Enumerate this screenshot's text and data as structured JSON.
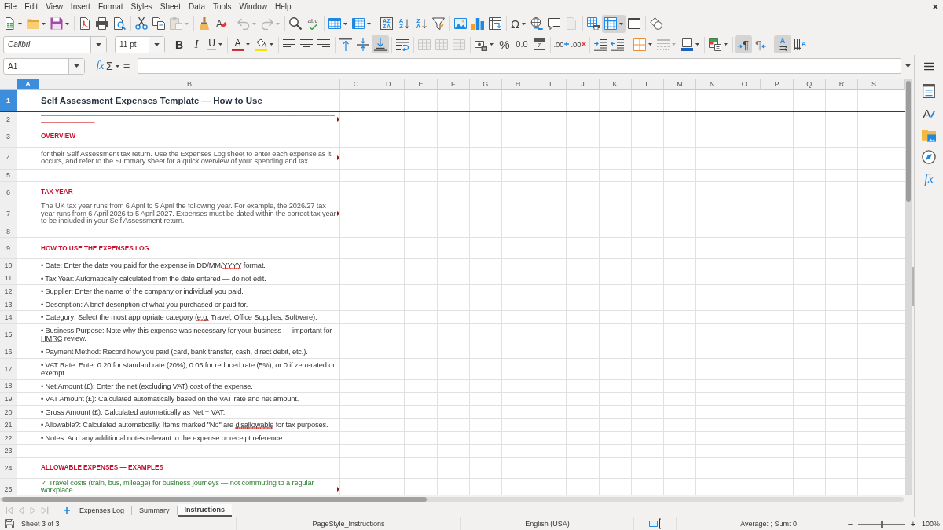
{
  "menu_bar": {
    "items": [
      "File",
      "Edit",
      "View",
      "Insert",
      "Format",
      "Styles",
      "Sheet",
      "Data",
      "Tools",
      "Window",
      "Help"
    ],
    "close": "×"
  },
  "standard_toolbar": {
    "groups": [
      [
        {
          "kind": "new",
          "dropdown": true,
          "disabled": false,
          "pressed": false
        },
        {
          "kind": "open",
          "dropdown": true,
          "disabled": false,
          "pressed": false
        },
        {
          "kind": "save",
          "dropdown": true,
          "disabled": false,
          "pressed": false
        }
      ],
      [
        {
          "kind": "export_pdf",
          "disabled": false,
          "pressed": false
        },
        {
          "kind": "print",
          "disabled": false,
          "pressed": false
        },
        {
          "kind": "print_preview",
          "disabled": false,
          "pressed": false
        }
      ],
      [
        {
          "kind": "cut",
          "disabled": false,
          "pressed": false
        },
        {
          "kind": "copy",
          "disabled": false,
          "pressed": false
        },
        {
          "kind": "paste",
          "dropdown": true,
          "disabled": true,
          "pressed": false
        }
      ],
      [
        {
          "kind": "clone_format",
          "disabled": false,
          "pressed": false
        },
        {
          "kind": "clear_format",
          "glyph": "A",
          "disabled": false,
          "pressed": false
        }
      ],
      [
        {
          "kind": "undo",
          "dropdown": true,
          "disabled": true,
          "pressed": false
        },
        {
          "kind": "redo",
          "dropdown": true,
          "disabled": true,
          "pressed": false
        }
      ],
      [
        {
          "kind": "find_replace",
          "disabled": false,
          "pressed": false
        },
        {
          "kind": "spelling",
          "glyph": "abc",
          "disabled": false,
          "pressed": false
        }
      ],
      [
        {
          "kind": "insert_rows",
          "dropdown": true,
          "disabled": false,
          "pressed": false
        },
        {
          "kind": "insert_columns",
          "dropdown": true,
          "disabled": false,
          "pressed": false
        }
      ],
      [
        {
          "kind": "sort",
          "glyph": "AZZA",
          "disabled": false,
          "pressed": false
        },
        {
          "kind": "sort_ascending",
          "glyph": "AZ",
          "disabled": false,
          "pressed": false
        },
        {
          "kind": "sort_descending",
          "glyph": "ZA",
          "disabled": false,
          "pressed": false
        },
        {
          "kind": "autofilter",
          "disabled": false,
          "pressed": false
        }
      ],
      [
        {
          "kind": "image",
          "disabled": false,
          "pressed": false
        },
        {
          "kind": "chart",
          "disabled": false,
          "pressed": false
        },
        {
          "kind": "pivot_table",
          "disabled": false,
          "pressed": false
        }
      ],
      [
        {
          "kind": "special_character",
          "glyph": "Ω",
          "dropdown": true,
          "disabled": false,
          "pressed": false
        },
        {
          "kind": "hyperlink",
          "disabled": false,
          "pressed": false
        },
        {
          "kind": "comment",
          "disabled": false,
          "pressed": false
        },
        {
          "kind": "header_footer",
          "disabled": true,
          "pressed": false
        }
      ],
      [
        {
          "kind": "print_area",
          "disabled": false,
          "pressed": false
        },
        {
          "kind": "freeze",
          "dropdown": true,
          "disabled": false,
          "pressed": true
        },
        {
          "kind": "split_window",
          "disabled": false,
          "pressed": false
        }
      ],
      [
        {
          "kind": "shapes",
          "disabled": false,
          "pressed": false
        }
      ]
    ]
  },
  "formatting_toolbar": {
    "font_name": "Calibri",
    "font_size": "11 pt",
    "groups": [
      [
        {
          "kind": "bold",
          "glyph": "B",
          "disabled": false,
          "pressed": false
        },
        {
          "kind": "italic",
          "glyph": "I",
          "disabled": false,
          "pressed": false
        },
        {
          "kind": "underline",
          "glyph": "U",
          "dropdown": true,
          "disabled": false,
          "pressed": false
        }
      ],
      [
        {
          "kind": "font_color",
          "glyph": "A",
          "dropdown": true,
          "disabled": false,
          "pressed": false
        },
        {
          "kind": "highlight",
          "dropdown": true,
          "disabled": false,
          "pressed": false
        }
      ],
      [
        {
          "kind": "align_left",
          "disabled": false,
          "pressed": false
        },
        {
          "kind": "align_center",
          "disabled": false,
          "pressed": false
        },
        {
          "kind": "align_right",
          "disabled": false,
          "pressed": false
        }
      ],
      [
        {
          "kind": "align_top",
          "disabled": false,
          "pressed": false
        },
        {
          "kind": "align_middle",
          "disabled": false,
          "pressed": false
        },
        {
          "kind": "align_bottom",
          "disabled": false,
          "pressed": true
        }
      ],
      [
        {
          "kind": "wrap",
          "disabled": false,
          "pressed": false
        }
      ],
      [
        {
          "kind": "merge_center",
          "disabled": true,
          "pressed": false
        },
        {
          "kind": "merge",
          "disabled": true,
          "pressed": false
        },
        {
          "kind": "unmerge",
          "disabled": true,
          "pressed": false
        }
      ],
      [
        {
          "kind": "currency",
          "dropdown": true,
          "disabled": false,
          "pressed": false
        },
        {
          "kind": "percent",
          "glyph": "%",
          "disabled": false,
          "pressed": false
        },
        {
          "kind": "number",
          "glyph": "0.0",
          "disabled": false,
          "pressed": false
        },
        {
          "kind": "date",
          "glyph": "7",
          "disabled": false,
          "pressed": false
        }
      ],
      [
        {
          "kind": "add_decimal",
          "glyph": ".00",
          "disabled": false,
          "pressed": false
        },
        {
          "kind": "delete_decimal",
          "glyph": ".00",
          "disabled": false,
          "pressed": false
        }
      ],
      [
        {
          "kind": "indent_increase",
          "disabled": false,
          "pressed": false
        },
        {
          "kind": "indent_decrease",
          "disabled": false,
          "pressed": false
        }
      ],
      [
        {
          "kind": "borders",
          "dropdown": true,
          "disabled": false,
          "pressed": false
        },
        {
          "kind": "border_style",
          "dropdown": true,
          "disabled": true,
          "pressed": false
        },
        {
          "kind": "border_color",
          "dropdown": true,
          "disabled": false,
          "pressed": false
        }
      ],
      [
        {
          "kind": "conditional",
          "dropdown": true,
          "disabled": false,
          "pressed": false
        }
      ],
      [
        {
          "kind": "ltr",
          "glyph": "¶",
          "disabled": false,
          "pressed": true
        },
        {
          "kind": "rtl",
          "glyph": "¶",
          "disabled": false,
          "pressed": false
        }
      ],
      [
        {
          "kind": "text_ltr",
          "glyph": "A",
          "disabled": false,
          "pressed": true
        },
        {
          "kind": "text_vertical",
          "glyph": "A",
          "disabled": false,
          "pressed": false
        }
      ]
    ]
  },
  "formula_bar": {
    "name_box": "A1",
    "buttons": [
      {
        "kind": "function_wizard",
        "glyph": "fx"
      },
      {
        "kind": "select_function",
        "glyph": "Σ",
        "dropdown": true
      },
      {
        "kind": "formula",
        "glyph": "="
      }
    ]
  },
  "sheet": {
    "columns": [
      {
        "label": "A",
        "selected": true,
        "frozen": true
      },
      {
        "label": "B",
        "selected": false,
        "frozen": false
      },
      {
        "label": "C",
        "selected": false,
        "frozen": false
      },
      {
        "label": "D",
        "selected": false,
        "frozen": false
      },
      {
        "label": "E",
        "selected": false,
        "frozen": false
      },
      {
        "label": "F",
        "selected": false,
        "frozen": false
      },
      {
        "label": "G",
        "selected": false,
        "frozen": false
      },
      {
        "label": "H",
        "selected": false,
        "frozen": false
      },
      {
        "label": "I",
        "selected": false,
        "frozen": false
      },
      {
        "label": "J",
        "selected": false,
        "frozen": false
      },
      {
        "label": "K",
        "selected": false,
        "frozen": false
      },
      {
        "label": "L",
        "selected": false,
        "frozen": false
      },
      {
        "label": "M",
        "selected": false,
        "frozen": false
      },
      {
        "label": "N",
        "selected": false,
        "frozen": false
      },
      {
        "label": "O",
        "selected": false,
        "frozen": false
      },
      {
        "label": "P",
        "selected": false,
        "frozen": false
      },
      {
        "label": "Q",
        "selected": false,
        "frozen": false
      },
      {
        "label": "R",
        "selected": false,
        "frozen": false
      },
      {
        "label": "S",
        "selected": false,
        "frozen": false
      }
    ],
    "rows": [
      {
        "number": "1",
        "selected": true,
        "frozen": true,
        "kind": "title",
        "text": "Self Assessment Expenses Template — How to Use",
        "overflow": false
      },
      {
        "number": "2",
        "selected": false,
        "frozen": false,
        "kind": "rule",
        "text": "───────────────────────────────────────────────────────────────────────",
        "overflow": true
      },
      {
        "number": "3",
        "selected": false,
        "frozen": false,
        "kind": "heading",
        "text": "OVERVIEW",
        "overflow": false
      },
      {
        "number": "4",
        "selected": false,
        "frozen": false,
        "kind": "paragraph",
        "text": "for their Self Assessment tax return. Use the Expenses Log sheet to enter each expense as it occurs, and refer to the Summary sheet for a quick overview of your spending and tax",
        "overflow": true
      },
      {
        "number": "5",
        "selected": false,
        "frozen": false,
        "kind": "blank",
        "overflow": false
      },
      {
        "number": "6",
        "selected": false,
        "frozen": false,
        "kind": "heading",
        "text": "TAX YEAR",
        "overflow": false
      },
      {
        "number": "7",
        "selected": false,
        "frozen": false,
        "kind": "paragraph",
        "text": "The UK tax year runs from 6 April to 5 April the following year. For example, the 2026/27 tax year runs from 6 April 2026 to 5 April 2027. Expenses must be dated within the correct tax year to be included in your Self Assessment return.",
        "overflow": true
      },
      {
        "number": "8",
        "selected": false,
        "frozen": false,
        "kind": "blank",
        "overflow": false
      },
      {
        "number": "9",
        "selected": false,
        "frozen": false,
        "kind": "heading",
        "text": "HOW TO USE THE EXPENSES LOG",
        "overflow": false
      },
      {
        "number": "10",
        "selected": false,
        "frozen": false,
        "kind": "bullet",
        "parts": [
          {
            "text": "• Date: Enter the date you paid for the expense in DD/MM/",
            "misspelled": false
          },
          {
            "text": "YYYY",
            "misspelled": true
          },
          {
            "text": " format.",
            "misspelled": false
          }
        ],
        "overflow": false
      },
      {
        "number": "11",
        "selected": false,
        "frozen": false,
        "kind": "bullet",
        "text": "• Tax Year: Automatically calculated from the date entered — do not edit.",
        "overflow": false
      },
      {
        "number": "12",
        "selected": false,
        "frozen": false,
        "kind": "bullet",
        "text": "• Supplier: Enter the name of the company or individual you paid.",
        "overflow": false
      },
      {
        "number": "13",
        "selected": false,
        "frozen": false,
        "kind": "bullet",
        "text": "• Description: A brief description of what you purchased or paid for.",
        "overflow": false
      },
      {
        "number": "14",
        "selected": false,
        "frozen": false,
        "kind": "bullet",
        "parts": [
          {
            "text": "• Category: Select the most appropriate category (",
            "misspelled": false
          },
          {
            "text": "e.g.",
            "misspelled": true
          },
          {
            "text": " Travel, Office Supplies, Software).",
            "misspelled": false
          }
        ],
        "overflow": false
      },
      {
        "number": "15",
        "selected": false,
        "frozen": false,
        "kind": "bullet",
        "parts": [
          {
            "text": "• Business Purpose: Note why this expense was necessary for your business — important for ",
            "misspelled": false
          },
          {
            "text": "HMRC",
            "misspelled": true
          },
          {
            "text": " review.",
            "misspelled": false
          }
        ],
        "overflow": false
      },
      {
        "number": "16",
        "selected": false,
        "frozen": false,
        "kind": "bullet",
        "text": "• Payment Method: Record how you paid (card, bank transfer, cash, direct debit, etc.).",
        "overflow": false
      },
      {
        "number": "17",
        "selected": false,
        "frozen": false,
        "kind": "bullet",
        "text": "• VAT Rate: Enter 0.20 for standard rate (20%), 0.05 for reduced rate (5%), or 0 if zero-rated or exempt.",
        "overflow": false
      },
      {
        "number": "18",
        "selected": false,
        "frozen": false,
        "kind": "bullet",
        "text": "• Net Amount (£): Enter the net (excluding VAT) cost of the expense.",
        "overflow": false
      },
      {
        "number": "19",
        "selected": false,
        "frozen": false,
        "kind": "bullet",
        "text": "• VAT Amount (£): Calculated automatically based on the VAT rate and net amount.",
        "overflow": false
      },
      {
        "number": "20",
        "selected": false,
        "frozen": false,
        "kind": "bullet",
        "text": "• Gross Amount (£): Calculated automatically as Net + VAT.",
        "overflow": false
      },
      {
        "number": "21",
        "selected": false,
        "frozen": false,
        "kind": "bullet",
        "parts": [
          {
            "text": "• Allowable?: Calculated automatically. Items marked \"No\" are ",
            "misspelled": false
          },
          {
            "text": "disallowable",
            "misspelled": true
          },
          {
            "text": " for tax purposes.",
            "misspelled": false
          }
        ],
        "overflow": false
      },
      {
        "number": "22",
        "selected": false,
        "frozen": false,
        "kind": "bullet",
        "text": "• Notes: Add any additional notes relevant to the expense or receipt reference.",
        "overflow": false
      },
      {
        "number": "23",
        "selected": false,
        "frozen": false,
        "kind": "blank",
        "overflow": false
      },
      {
        "number": "24",
        "selected": false,
        "frozen": false,
        "kind": "heading",
        "text": "ALLOWABLE EXPENSES — EXAMPLES",
        "overflow": false
      },
      {
        "number": "25",
        "selected": false,
        "frozen": false,
        "kind": "check_item",
        "text": "✓ Travel costs (train, bus, mileage) for business journeys — not commuting to a regular workplace",
        "overflow": true
      }
    ]
  },
  "sidebar": {
    "tabs": [
      {
        "kind": "properties",
        "selected": false
      },
      {
        "kind": "styles",
        "glyph": "A",
        "selected": false
      },
      {
        "kind": "gallery",
        "selected": false
      },
      {
        "kind": "navigator",
        "selected": false
      },
      {
        "kind": "functions",
        "glyph": "fx",
        "selected": false
      }
    ]
  },
  "sheet_tabs": {
    "navigation": [
      {
        "kind": "first",
        "disabled": true
      },
      {
        "kind": "previous",
        "disabled": true
      },
      {
        "kind": "next",
        "disabled": true
      },
      {
        "kind": "last",
        "disabled": true
      }
    ],
    "tabs": [
      {
        "label": "Expenses Log",
        "selected": false
      },
      {
        "label": "Summary",
        "selected": false
      },
      {
        "label": "Instructions",
        "selected": true
      }
    ]
  },
  "status_bar": {
    "sheet_position": "Sheet 3 of 3",
    "page_style": "PageStyle_Instructions",
    "language": "English (USA)",
    "selection_summary": "Average: ; Sum: 0",
    "zoom": {
      "decrease": "−",
      "level": 0.5,
      "increase": "+",
      "reading": "100%"
    }
  }
}
